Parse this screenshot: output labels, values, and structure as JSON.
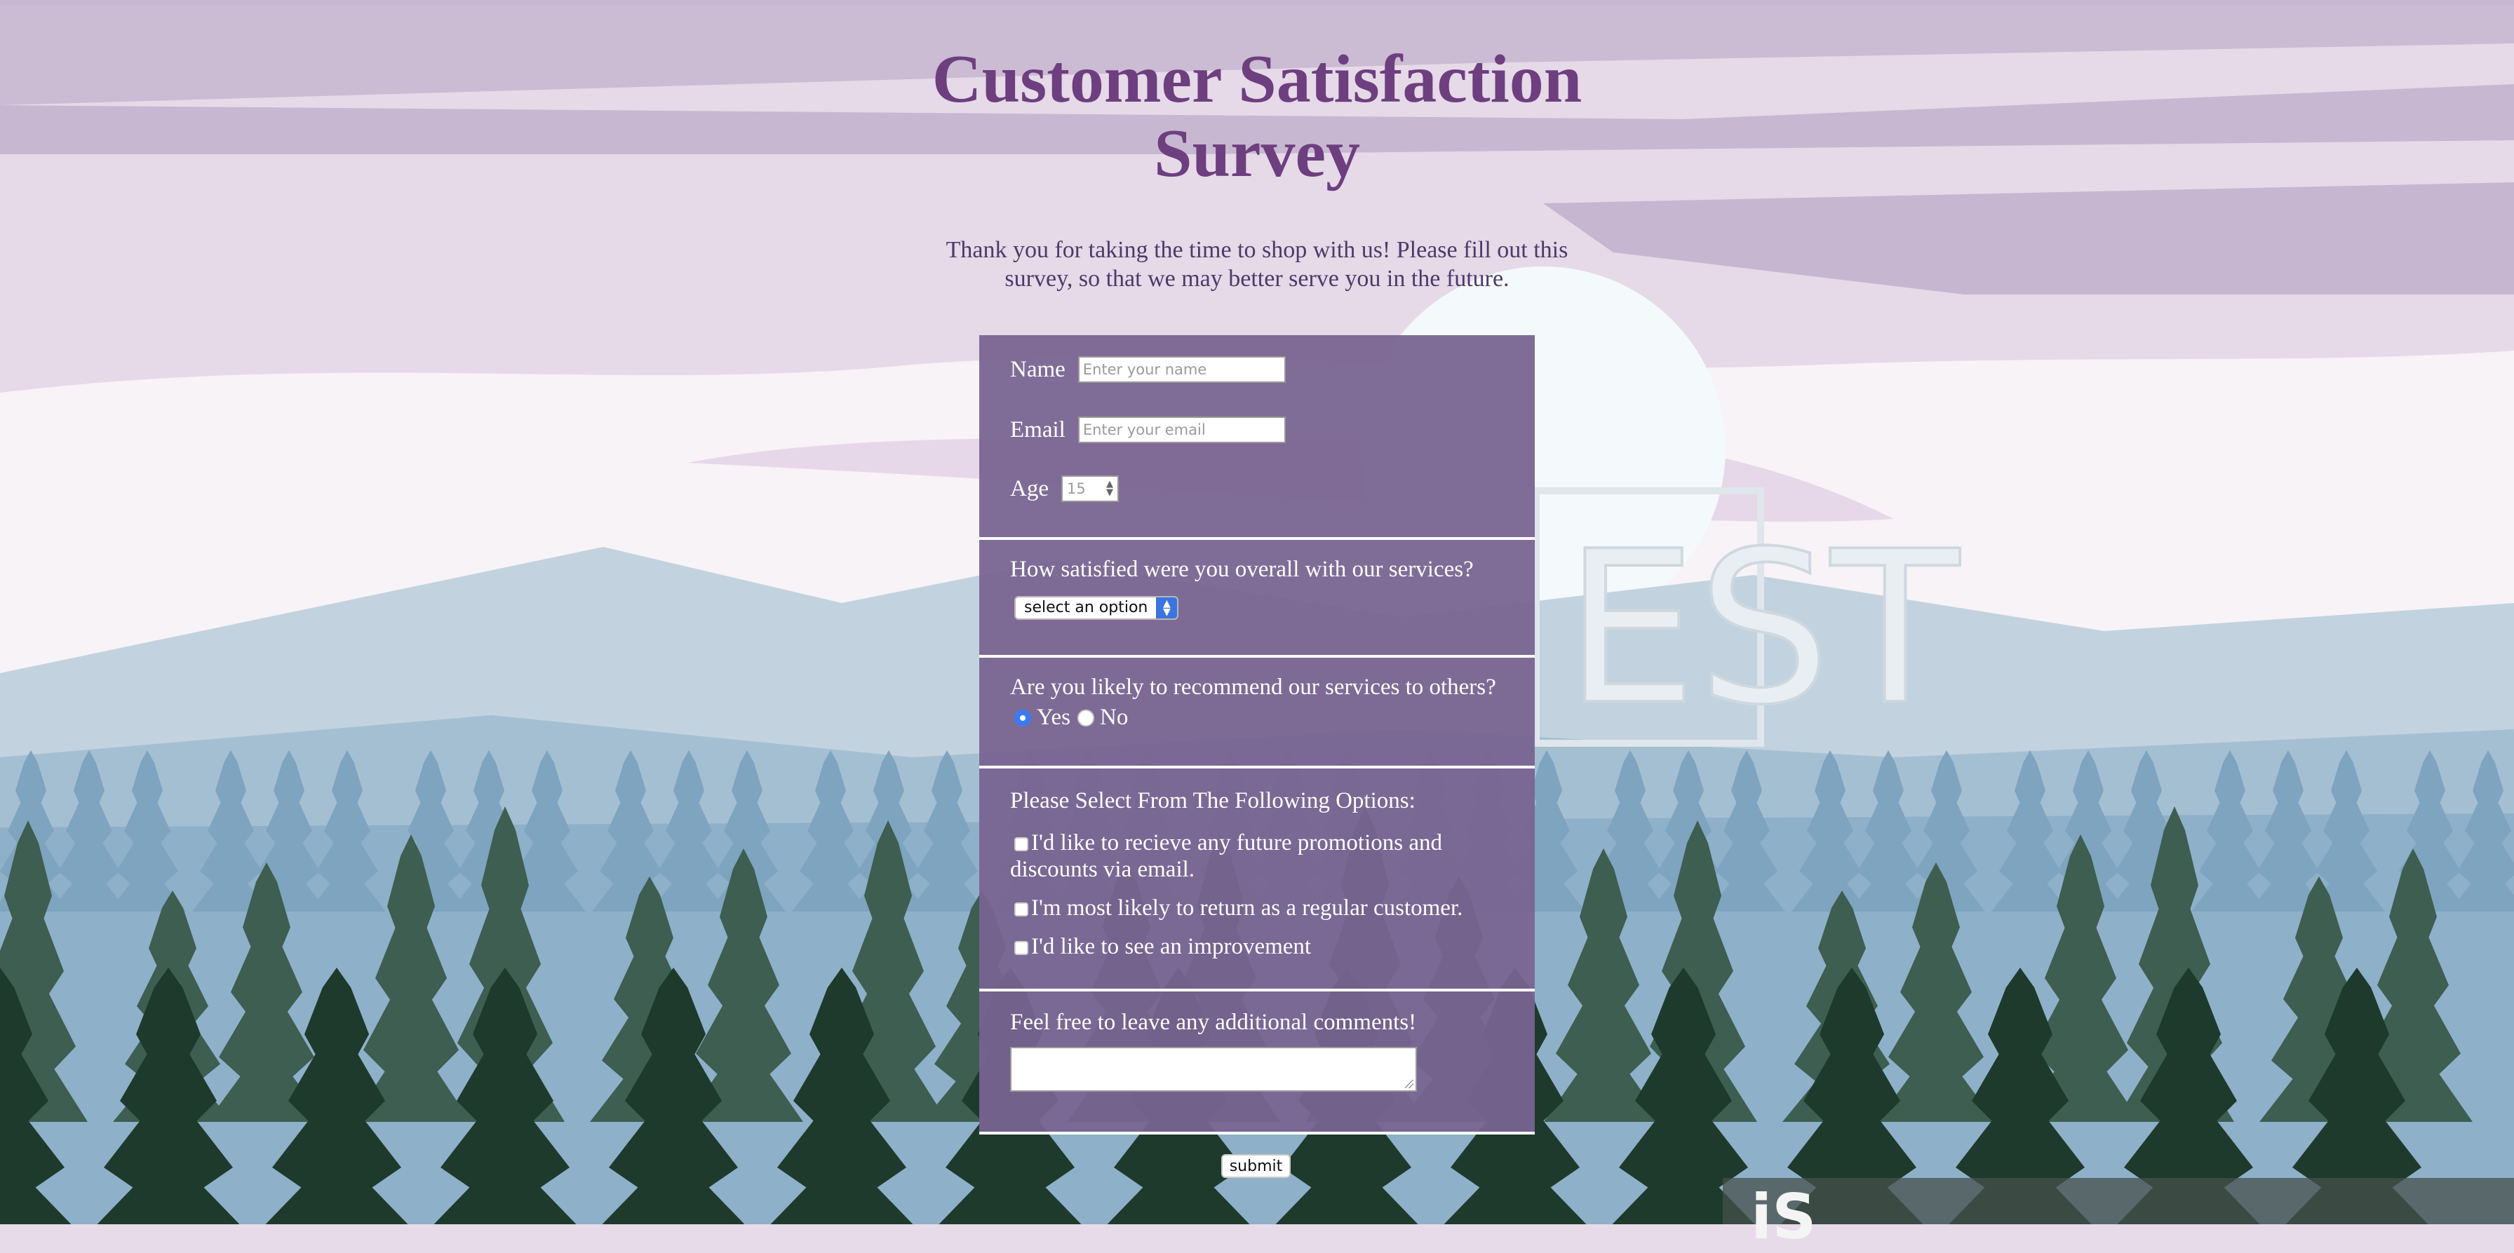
{
  "page": {
    "title": "Customer Satisfaction Survey",
    "intro": "Thank you for taking the time to shop with us! Please fill out this survey, so that we may better serve you in the future."
  },
  "form": {
    "name": {
      "label": "Name",
      "placeholder": "Enter your name"
    },
    "email": {
      "label": "Email",
      "placeholder": "Enter your email"
    },
    "age": {
      "label": "Age",
      "value": "15"
    },
    "satisfaction": {
      "question": "How satisfied were you overall with our services?",
      "selected": "select an option"
    },
    "recommend": {
      "question": "Are you likely to recommend our services to others?",
      "options": [
        {
          "label": "Yes",
          "checked": true
        },
        {
          "label": "No",
          "checked": false
        }
      ]
    },
    "options": {
      "heading": "Please Select From The Following Options:",
      "items": [
        {
          "label": "I'd like to recieve any future promotions and discounts via email.",
          "checked": false
        },
        {
          "label": "I'm most likely to return as a regular customer.",
          "checked": false
        },
        {
          "label": "I'd like to see an improvement",
          "checked": false
        }
      ]
    },
    "comments": {
      "label": "Feel free to leave any additional comments!"
    },
    "submit_label": "submit"
  },
  "background": {
    "watermark_text": "EST",
    "badge_text": "iS"
  },
  "colors": {
    "title": "#6d3f7f",
    "intro": "#4c3a68",
    "panel": "#7a6692",
    "radio_checked": "#3a7bf1"
  }
}
